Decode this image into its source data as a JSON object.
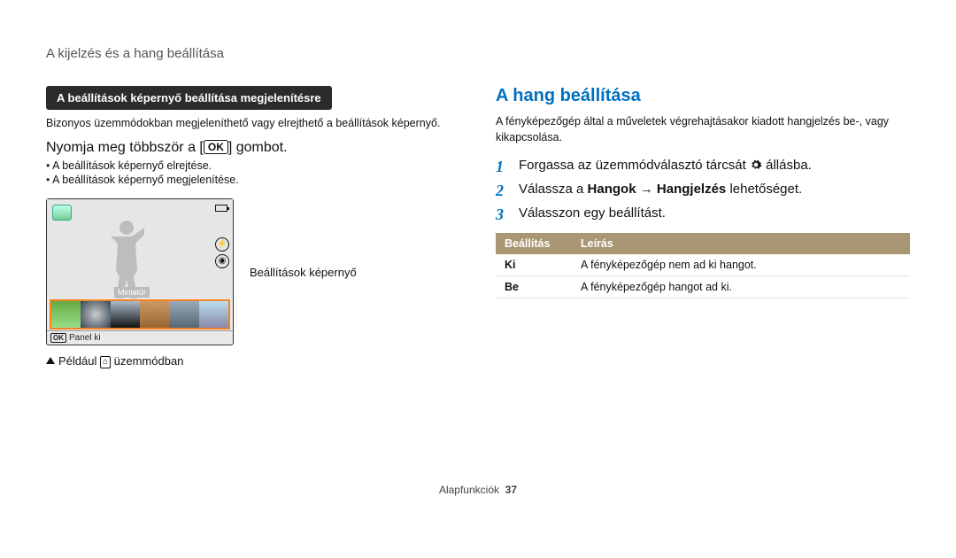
{
  "breadcrumb": "A kijelzés és a hang beállítása",
  "left": {
    "pill": "A beállítások képernyő beállítása megjelenítésre",
    "intro": "Bizonyos üzemmódokban megjeleníthető vagy elrejthető a beállítások képernyő.",
    "instr_pre": "Nyomja meg többször a [",
    "instr_key": "OK",
    "instr_post": "] gombot.",
    "bullets": [
      "A beállítások képernyő elrejtése.",
      "A beállítások képernyő megjelenítése."
    ],
    "screen": {
      "mini_label": "Miniatűr",
      "panel_key": "OK",
      "panel_text": "Panel ki"
    },
    "side_caption": "Beállítások képernyő",
    "below_pre": "Például ",
    "below_icon_alt": "home",
    "below_post": " üzemmódban"
  },
  "right": {
    "title": "A hang beállítása",
    "intro": "A fényképezőgép által a műveletek végrehajtásakor kiadott hangjelzés be-, vagy kikapcsolása.",
    "steps": [
      {
        "n": "1",
        "pre": "Forgassa az üzemmódválasztó tárcsát ",
        "icon": "gear",
        "post": " állásba."
      },
      {
        "n": "2",
        "pre": "Válassza a ",
        "b1": "Hangok",
        "arrow": " → ",
        "b2": "Hangjelzés",
        "post": " lehetőséget."
      },
      {
        "n": "3",
        "pre": "Válasszon egy beállítást.",
        "post": ""
      }
    ],
    "table": {
      "h1": "Beállítás",
      "h2": "Leírás",
      "rows": [
        {
          "k": "Ki",
          "v": "A fényképezőgép nem ad ki hangot."
        },
        {
          "k": "Be",
          "v": "A fényképezőgép hangot ad ki."
        }
      ]
    }
  },
  "footer": {
    "label": "Alapfunkciók",
    "page": "37"
  }
}
